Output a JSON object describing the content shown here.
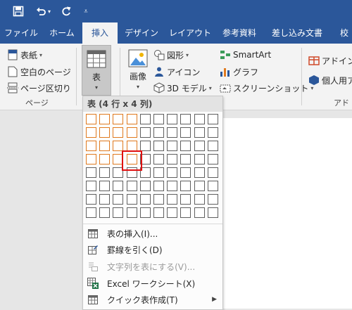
{
  "qat": {
    "save_icon": "save-icon",
    "undo_icon": "undo-icon",
    "redo_icon": "redo-icon",
    "customize_icon": "customize-qat-icon"
  },
  "tabs": [
    {
      "label": "ファイル"
    },
    {
      "label": "ホーム"
    },
    {
      "label": "挿入",
      "active": true
    },
    {
      "label": "デザイン"
    },
    {
      "label": "レイアウト"
    },
    {
      "label": "参考資料"
    },
    {
      "label": "差し込み文書"
    },
    {
      "label": "校"
    }
  ],
  "ribbon": {
    "pages_group": {
      "label": "ページ",
      "cover_page": "表紙",
      "blank_page": "空白のページ",
      "page_break": "ページ区切り"
    },
    "table_button": {
      "label": "表"
    },
    "illustrations": {
      "pictures": "画像",
      "shapes": "図形",
      "icons": "アイコン",
      "models3d": "3D モデル",
      "smartart": "SmartArt",
      "chart": "グラフ",
      "screenshot": "スクリーンショット"
    },
    "addins": {
      "get_addins": "アドインを",
      "personal_addins": "個人用ア",
      "label": "アド"
    }
  },
  "table_menu": {
    "title": "表 (4 行 x 4 列)",
    "grid": {
      "cols": 10,
      "rows": 8,
      "selected_rows": 4,
      "selected_cols": 4
    },
    "items": [
      {
        "label": "表の挿入(I)...",
        "icon": "insert-table-icon",
        "disabled": false,
        "submenu": false
      },
      {
        "label": "罫線を引く(D)",
        "icon": "draw-table-icon",
        "disabled": false,
        "submenu": false
      },
      {
        "label": "文字列を表にする(V)...",
        "icon": "convert-text-icon",
        "disabled": true,
        "submenu": false
      },
      {
        "label": "Excel ワークシート(X)",
        "icon": "excel-icon",
        "disabled": false,
        "submenu": false
      },
      {
        "label": "クイック表作成(T)",
        "icon": "quick-tables-icon",
        "disabled": false,
        "submenu": true
      }
    ]
  },
  "colors": {
    "accent": "#2b579a",
    "grid_selected": "#e07a1f",
    "hover_box": "#e01010"
  }
}
